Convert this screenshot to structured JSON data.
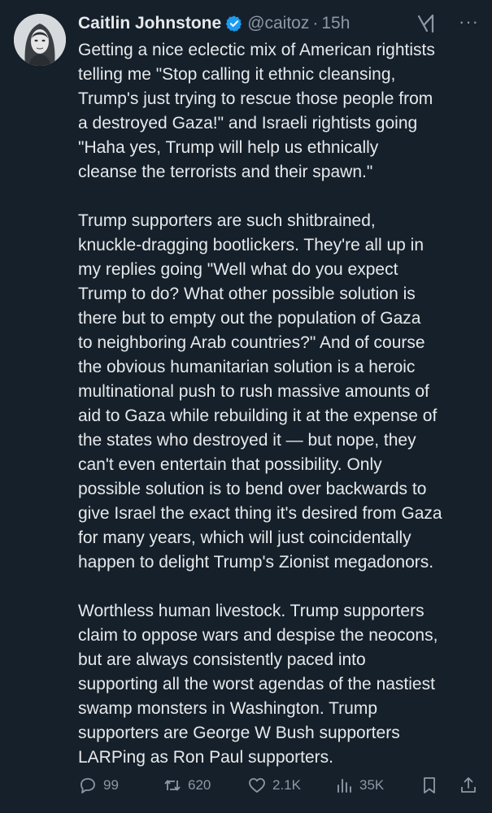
{
  "tweet": {
    "author_name": "Caitlin Johnstone",
    "handle": "@caitoz",
    "separator": "·",
    "time": "15h",
    "more": "···",
    "paragraphs": [
      "Getting a nice eclectic mix of American rightists\ntelling me \"Stop calling it ethnic cleansing,\nTrump's just trying to rescue those people from\na destroyed Gaza!\" and Israeli rightists going\n\"Haha yes, Trump will help us ethnically\ncleanse the terrorists and their spawn.\"",
      "Trump supporters are such shitbrained,\nknuckle-dragging bootlickers. They're all up in\nmy replies going \"Well what do you expect\nTrump to do? What other possible solution is\nthere but to empty out the population of Gaza\nto neighboring Arab countries?\" And of course\nthe obvious humanitarian solution is a heroic\nmultinational push to rush massive amounts of\naid to Gaza while rebuilding it at the expense of\nthe states who destroyed it — but nope, they\ncan't even entertain that possibility. Only\npossible solution is to bend over backwards to\ngive Israel the exact thing it's desired from Gaza\nfor many years, which will just coincidentally\nhappen to delight Trump's Zionist megadonors.",
      "Worthless human livestock. Trump supporters\nclaim to oppose wars and despise the neocons,\nbut are always consistently paced into\nsupporting all the worst agendas of the nastiest\nswamp monsters in Washington. Trump\nsupporters are George W Bush supporters\nLARPing as Ron Paul supporters."
    ],
    "actions": {
      "replies": "99",
      "retweets": "620",
      "likes": "2.1K",
      "views": "35K"
    },
    "icons": [
      "verified-badge-icon",
      "grok-icon",
      "more-icon",
      "reply-icon",
      "retweet-icon",
      "like-icon",
      "views-icon",
      "bookmark-icon",
      "share-icon"
    ],
    "colors": {
      "background": "#15202b",
      "text": "#e7e9ea",
      "muted": "#8b98a5",
      "verified": "#1d9bf0"
    }
  }
}
